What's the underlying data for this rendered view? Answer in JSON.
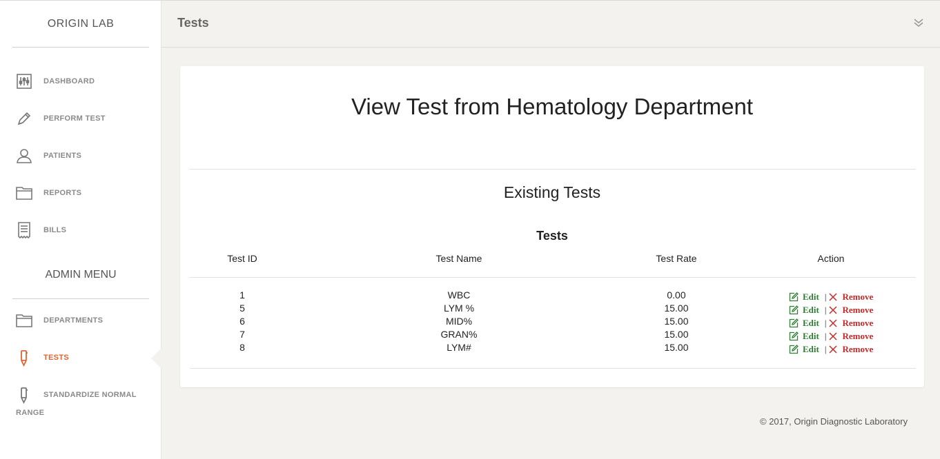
{
  "sidebar": {
    "brand": "ORIGIN LAB",
    "items": [
      {
        "label": "DASHBOARD",
        "icon": "dashboard-sliders-icon"
      },
      {
        "label": "PERFORM TEST",
        "icon": "pen-icon"
      },
      {
        "label": "PATIENTS",
        "icon": "user-icon"
      },
      {
        "label": "REPORTS",
        "icon": "folder-icon"
      },
      {
        "label": "BILLS",
        "icon": "receipt-icon"
      }
    ],
    "admin_title": "ADMIN MENU",
    "admin_items": [
      {
        "label": "DEPARTMENTS",
        "icon": "folder-icon"
      },
      {
        "label": "TESTS",
        "icon": "marker-icon",
        "active": true
      },
      {
        "label": "STANDARDIZE NORMAL",
        "label_wrap": "RANGE",
        "icon": "marker-icon"
      }
    ]
  },
  "header": {
    "title": "Tests",
    "toggle_icon": "double-chevron-down-icon"
  },
  "main": {
    "heading": "View Test from Hematology Department",
    "subheading": "Existing Tests",
    "table": {
      "caption": "Tests",
      "columns": [
        "Test ID",
        "Test Name",
        "Test Rate",
        "Action"
      ],
      "rows": [
        {
          "id": "1",
          "name": "WBC",
          "rate": "0.00"
        },
        {
          "id": "5",
          "name": "LYM %",
          "rate": "15.00"
        },
        {
          "id": "6",
          "name": "MID%",
          "rate": "15.00"
        },
        {
          "id": "7",
          "name": "GRAN%",
          "rate": "15.00"
        },
        {
          "id": "8",
          "name": "LYM#",
          "rate": "15.00"
        }
      ],
      "edit_label": "Edit",
      "remove_label": "Remove",
      "separator": "|"
    }
  },
  "footer": {
    "text": "© 2017, Origin Diagnostic Laboratory"
  },
  "colors": {
    "accent": "#e2622f",
    "edit": "#2e7d32",
    "remove": "#c62828"
  }
}
